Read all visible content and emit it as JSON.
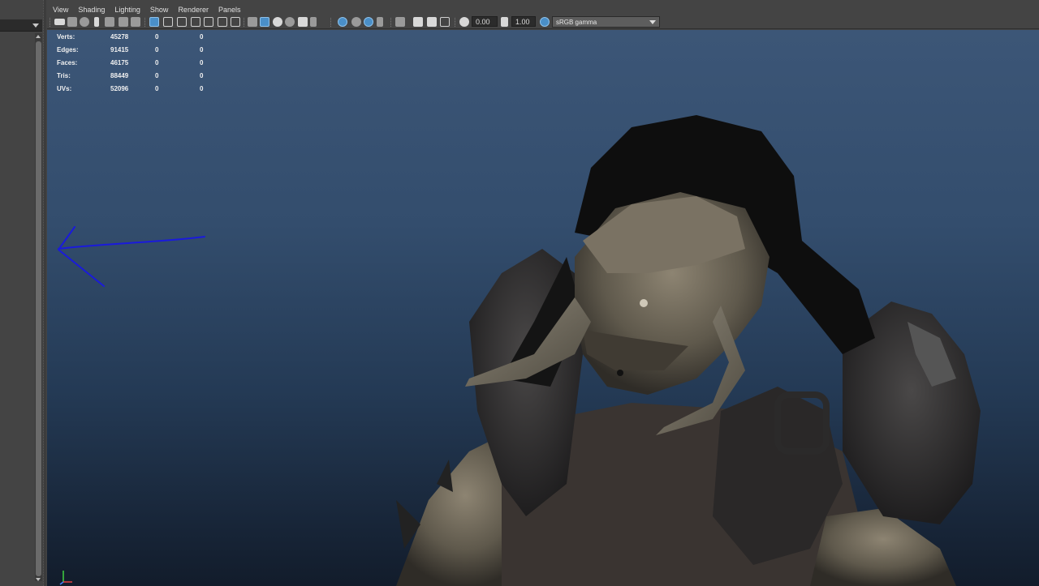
{
  "menus": [
    "View",
    "Shading",
    "Lighting",
    "Show",
    "Renderer",
    "Panels"
  ],
  "toolbar": {
    "exposure_value": "0.00",
    "gamma_value": "1.00",
    "color_space": "sRGB gamma",
    "icons": [
      "camera-icon",
      "camera-attributes-icon",
      "bookmark-icon",
      "image-plane-icon",
      "grid-icon",
      "film-gate-icon",
      "resolution-gate-icon",
      "safe-action-icon",
      "field-chart-icon",
      "wireframe-icon",
      "smooth-shade-icon",
      "default-lighting-icon",
      "textured-icon",
      "use-all-lights-icon",
      "shadows-icon",
      "ambient-occlusion-icon",
      "motion-blur-icon",
      "anti-aliasing-icon",
      "isolate-select-icon",
      "xray-icon",
      "xray-joints-icon",
      "backface-culling-icon",
      "exposure-icon",
      "gamma-icon",
      "color-management-icon"
    ]
  },
  "hud": {
    "rows": [
      {
        "label": "Verts:",
        "value": "45278",
        "col2": "0",
        "col3": "0"
      },
      {
        "label": "Edges:",
        "value": "91415",
        "col2": "0",
        "col3": "0"
      },
      {
        "label": "Faces:",
        "value": "46175",
        "col2": "0",
        "col3": "0"
      },
      {
        "label": "Tris:",
        "value": "88449",
        "col2": "0",
        "col3": "0"
      },
      {
        "label": "UVs:",
        "value": "52096",
        "col2": "0",
        "col3": "0"
      }
    ]
  },
  "gizmo": {
    "x_color": "#e04040",
    "y_color": "#40d040",
    "z_color": "#4080ff"
  },
  "colors": {
    "viewport_top": "#3c5677",
    "viewport_bottom": "#121c2b",
    "accent": "#4a8fc8",
    "annotation_arrow": "#1a1adc"
  }
}
